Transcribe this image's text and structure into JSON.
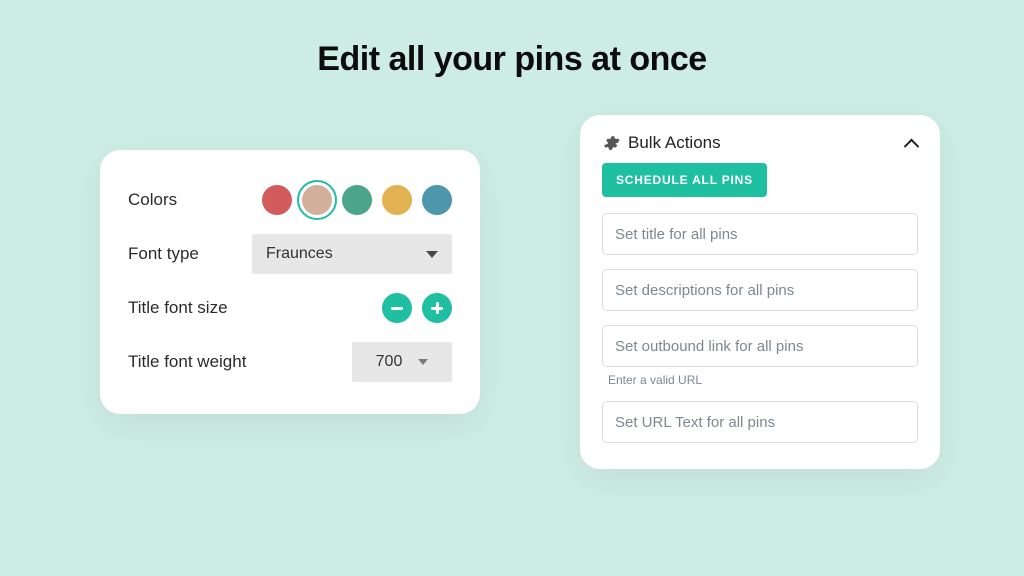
{
  "headline": "Edit all your pins at once",
  "styleCard": {
    "labels": {
      "colors": "Colors",
      "fontType": "Font type",
      "titleFontSize": "Title font size",
      "titleFontWeight": "Title font weight"
    },
    "palette": [
      {
        "hex": "#d35b5b",
        "selected": false
      },
      {
        "hex": "#d3b09b",
        "selected": true
      },
      {
        "hex": "#4aa58b",
        "selected": false
      },
      {
        "hex": "#e1b24f",
        "selected": false
      },
      {
        "hex": "#4e96ab",
        "selected": false
      }
    ],
    "fontType": "Fraunces",
    "titleFontWeight": "700"
  },
  "bulkCard": {
    "icon": "gear-icon",
    "title": "Bulk Actions",
    "scheduleButton": "SCHEDULE ALL PINS",
    "fields": {
      "title": "Set title for all pins",
      "descriptions": "Set descriptions for all pins",
      "outbound": "Set outbound link for all pins",
      "outboundHelper": "Enter a valid URL",
      "urlText": "Set URL Text for all pins"
    }
  },
  "colors": {
    "accent": "#1fbfa1",
    "background": "#cdece4"
  }
}
